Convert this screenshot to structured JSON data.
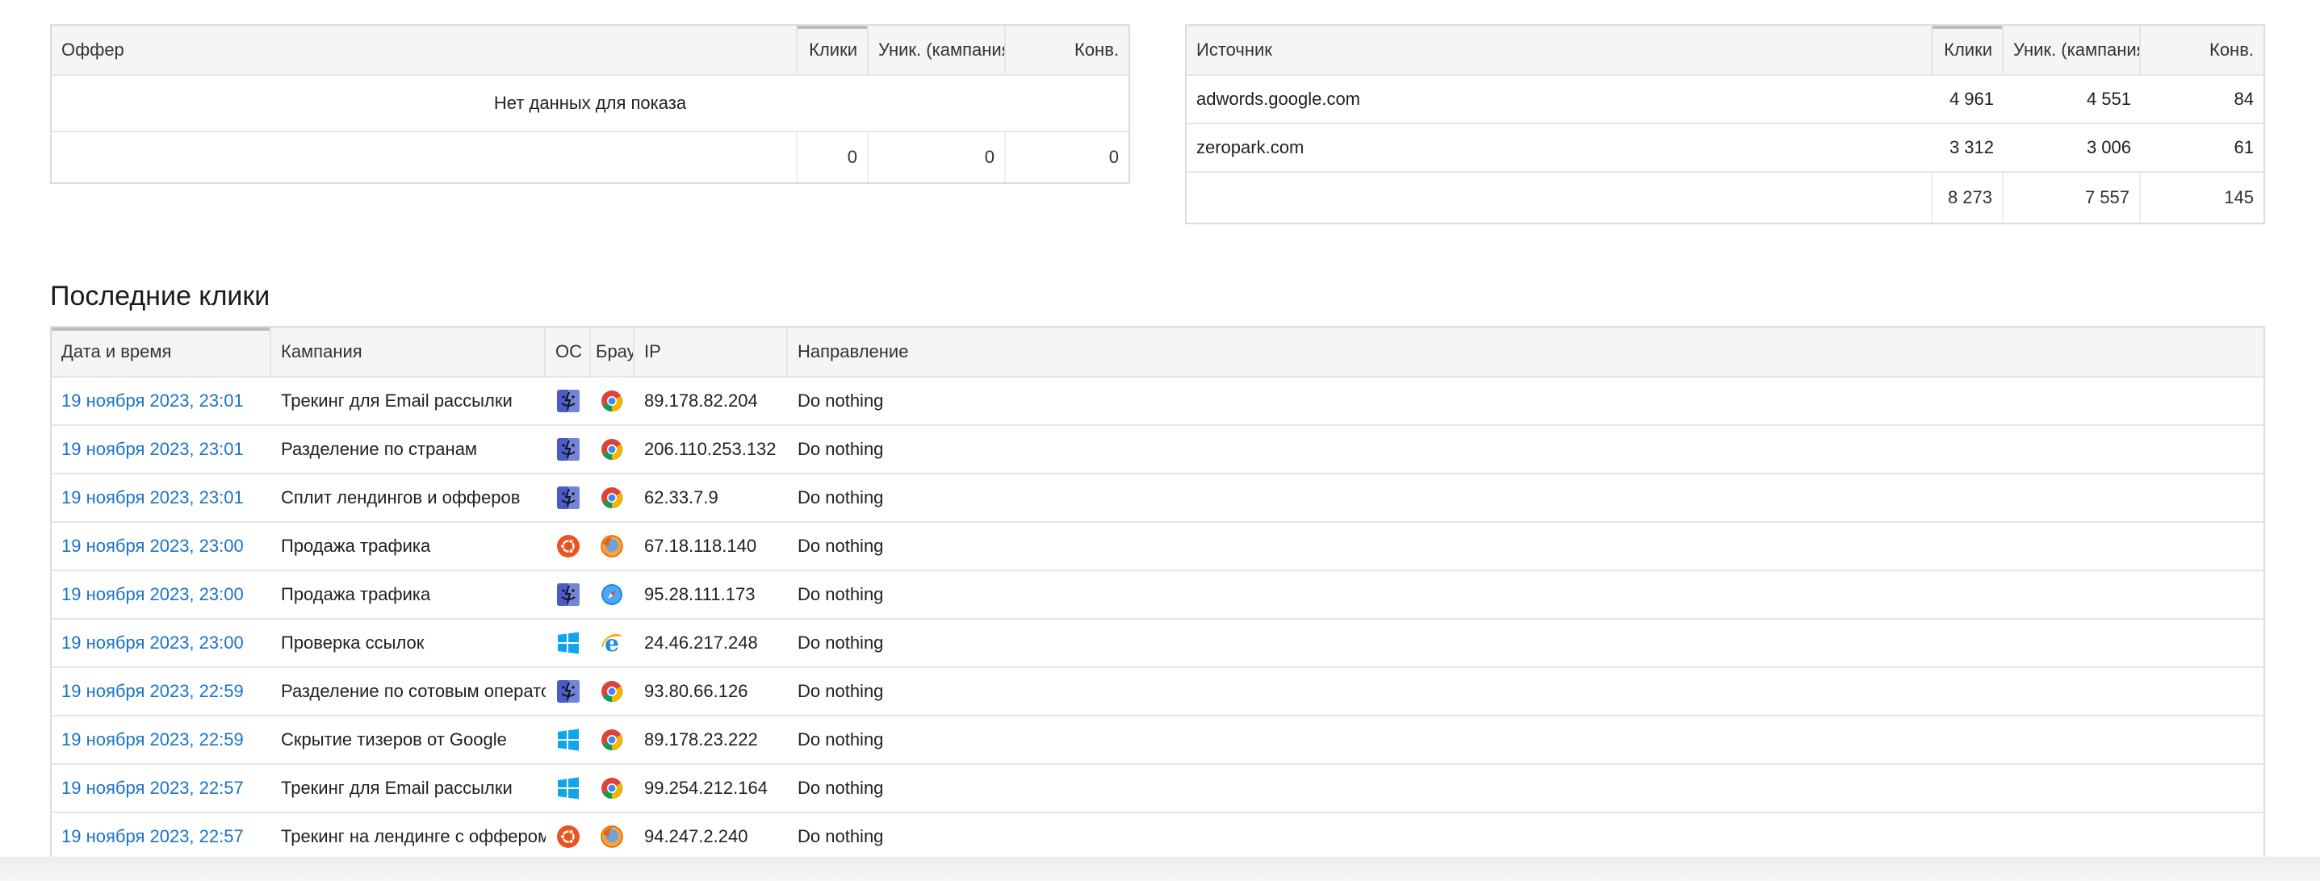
{
  "offers_table": {
    "columns": [
      "Оффер",
      "Клики",
      "Уник. (кампания)",
      "Конв."
    ],
    "empty_text": "Нет данных для показа",
    "totals": [
      "",
      "0",
      "0",
      "0"
    ]
  },
  "sources_table": {
    "columns": [
      "Источник",
      "Клики",
      "Уник. (кампания)",
      "Конв."
    ],
    "rows": [
      {
        "source": "adwords.google.com",
        "clicks": "4 961",
        "unique": "4 551",
        "conv": "84"
      },
      {
        "source": "zeropark.com",
        "clicks": "3 312",
        "unique": "3 006",
        "conv": "61"
      }
    ],
    "totals": [
      "",
      "8 273",
      "7 557",
      "145"
    ]
  },
  "recent_clicks": {
    "title": "Последние клики",
    "columns": [
      "Дата и время",
      "Кампания",
      "ОС",
      "Браузер",
      "IP",
      "Направление"
    ],
    "rows": [
      {
        "datetime": "19 ноября 2023, 23:01",
        "campaign": "Трекинг для Email рассылки",
        "os": "macos-finder-icon",
        "browser": "chrome-icon",
        "ip": "89.178.82.204",
        "direction": "Do nothing"
      },
      {
        "datetime": "19 ноября 2023, 23:01",
        "campaign": "Разделение по странам",
        "os": "macos-finder-icon",
        "browser": "chrome-icon",
        "ip": "206.110.253.132",
        "direction": "Do nothing"
      },
      {
        "datetime": "19 ноября 2023, 23:01",
        "campaign": "Сплит лендингов и офферов",
        "os": "macos-finder-icon",
        "browser": "chrome-icon",
        "ip": "62.33.7.9",
        "direction": "Do nothing"
      },
      {
        "datetime": "19 ноября 2023, 23:00",
        "campaign": "Продажа трафика",
        "os": "ubuntu-icon",
        "browser": "firefox-icon",
        "ip": "67.18.118.140",
        "direction": "Do nothing"
      },
      {
        "datetime": "19 ноября 2023, 23:00",
        "campaign": "Продажа трафика",
        "os": "macos-finder-icon",
        "browser": "safari-icon",
        "ip": "95.28.111.173",
        "direction": "Do nothing"
      },
      {
        "datetime": "19 ноября 2023, 23:00",
        "campaign": "Проверка ссылок",
        "os": "windows-icon",
        "browser": "ie-icon",
        "ip": "24.46.217.248",
        "direction": "Do nothing"
      },
      {
        "datetime": "19 ноября 2023, 22:59",
        "campaign": "Разделение по сотовым операторам",
        "os": "macos-finder-icon",
        "browser": "chrome-icon",
        "ip": "93.80.66.126",
        "direction": "Do nothing"
      },
      {
        "datetime": "19 ноября 2023, 22:59",
        "campaign": "Скрытие тизеров от Google",
        "os": "windows-icon",
        "browser": "chrome-icon",
        "ip": "89.178.23.222",
        "direction": "Do nothing"
      },
      {
        "datetime": "19 ноября 2023, 22:57",
        "campaign": "Трекинг для Email рассылки",
        "os": "windows-icon",
        "browser": "chrome-icon",
        "ip": "99.254.212.164",
        "direction": "Do nothing"
      },
      {
        "datetime": "19 ноября 2023, 22:57",
        "campaign": "Трекинг на лендинге с оффером",
        "os": "ubuntu-icon",
        "browser": "firefox-icon",
        "ip": "94.247.2.240",
        "direction": "Do nothing"
      }
    ]
  },
  "colors": {
    "link": "#1a73c8",
    "header_bg": "#f5f5f5",
    "border": "#dcdcdc"
  }
}
